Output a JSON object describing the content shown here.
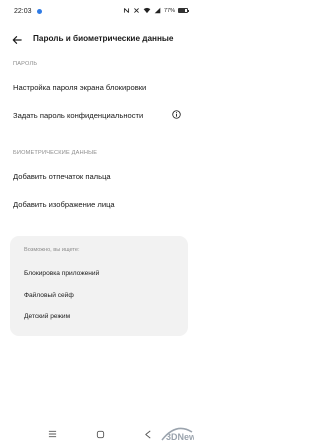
{
  "status_bar": {
    "time": "22:03",
    "battery": "77%",
    "icons": [
      "nfc-icon",
      "wifi-icon",
      "sim-off-icon",
      "battery-icon"
    ]
  },
  "header": {
    "title": "Пароль и биометрические данные",
    "back_icon": "back-arrow-icon"
  },
  "password_section": {
    "label": "ПАРОЛЬ",
    "items": [
      {
        "label": "Настройка пароля экрана блокировки"
      },
      {
        "label": "Задать пароль конфиденциальности",
        "icon": "info-icon"
      }
    ]
  },
  "biometric_section": {
    "label": "БИОМЕТРИЧЕСКИЕ ДАННЫЕ",
    "items": [
      {
        "label": "Добавить отпечаток пальца"
      },
      {
        "label": "Добавить изображение лица"
      }
    ]
  },
  "suggestions": {
    "title": "Возможно, вы ищете:",
    "items": [
      "Блокировка приложений",
      "Файловый сейф",
      "Детский режим"
    ]
  },
  "nav_bar": {
    "buttons": [
      "menu-icon",
      "home-icon",
      "back-icon"
    ]
  },
  "watermark": {
    "text": "3DNews"
  },
  "colors": {
    "accent": "#2f7be5",
    "card_bg": "#f2f2f2",
    "section_label": "#8b8b8b"
  }
}
